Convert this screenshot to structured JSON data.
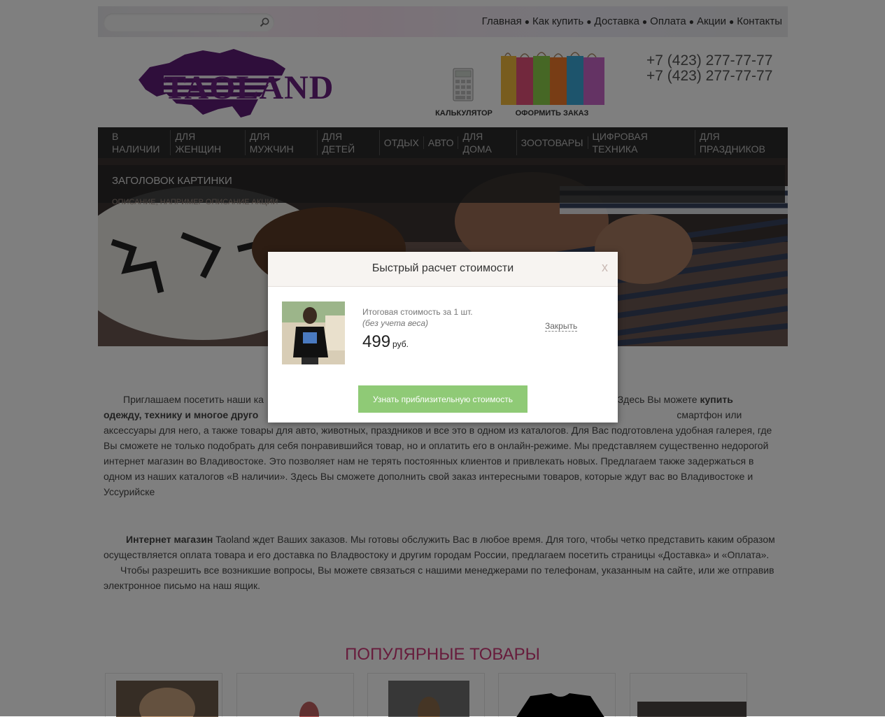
{
  "search": {
    "value": "",
    "placeholder": ""
  },
  "top_nav": [
    "Главная",
    "Как купить",
    "Доставка",
    "Оплата",
    "Акции",
    "Контакты"
  ],
  "header": {
    "logo_text": "TAOLAND",
    "calc_label": "КАЛЬКУЛЯТОР",
    "order_label": "ОФОРМИТЬ ЗАКАЗ",
    "phones": [
      "+7 (423) 277-77-77",
      "+7 (423) 277-77-77"
    ]
  },
  "categories": [
    "В НАЛИЧИИ",
    "ДЛЯ ЖЕНЩИН",
    "ДЛЯ МУЖЧИН",
    "ДЛЯ ДЕТЕЙ",
    "ОТДЫХ",
    "АВТО",
    "ДЛЯ ДОМА",
    "ЗООТОВАРЫ",
    "ЦИФРОВАЯ ТЕХНИКА",
    "ДЛЯ ПРАЗДНИКОВ"
  ],
  "banner": {
    "title": "ЗАГОЛОВОК КАРТИНКИ",
    "description": "ОПИСАНИЕ, НАПРИМЕР ОПИСАНИЕ АКЦИИ"
  },
  "article": {
    "p1_start": "Приглашаем посетить наши ка",
    "p1_mid": ". Здесь Вы можете ",
    "p1_bold1": "купить",
    "p1_line2_bold": "одежду, технику и многое друго",
    "p1_line2_tail": "смартфон или аксессуары для",
    "p1_rest": "него, а также товары для авто, животных, праздников и все это в одном из каталогов. Для Вас подготовлена удобная галерея, где Вы сможете не только подобрать для себя понравившийся товар, но и оплатить его в онлайн-режиме. Мы представляем существенно недорогой интернет магазин во Владивостоке. Это позволяет нам не терять постоянных клиентов и привлекать новых. Предлагаем также задержаться в одном из наших каталогов «В наличии». Здесь Вы сможете дополнить свой заказ интересными товаров, которые ждут вас во Владивостоке и Уссурийске",
    "p2_bold": "Интернет магазин",
    "p2_text": " Taoland ждет Ваших заказов. Мы готовы обслужить Вас в любое время. Для того, чтобы четко представить каким образом осуществляется оплата товара и его доставка по Владвостоку и другим городам России, предлагаем посетить страницы «Доставка» и «Оплата».",
    "p3_text": "Чтобы разрешить все возникшие вопросы, Вы можете связаться с нашими менеджерами по телефонам, указанным на сайте, или же отправив электронное письмо на наш ящик."
  },
  "popular": {
    "title": "ПОПУЛЯРНЫЕ ТОВАРЫ"
  },
  "modal": {
    "title": "Быстрый расчет стоимости",
    "close_x": "x",
    "total_label": "Итоговая стоимость за 1 шт.",
    "weight_note": "(без учета веса)",
    "price": "499",
    "currency": "руб.",
    "close_link": "Закрыть",
    "button_label": "Узнать приблизительную стоимость"
  },
  "colors": {
    "accent_green": "#8fca76",
    "popular_title": "#cf3878",
    "nav_background": "#2a2a2a",
    "logo_purple": "#6b2080"
  },
  "icons": [
    "search-icon",
    "calculator-icon",
    "shopping-bags-icon",
    "logo-map-icon"
  ]
}
